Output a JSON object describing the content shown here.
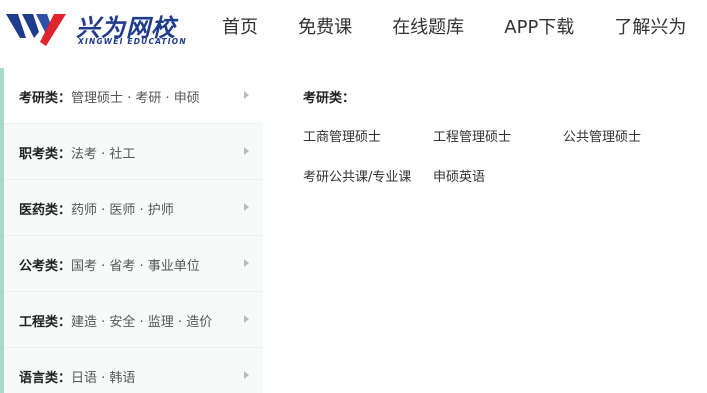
{
  "header": {
    "logo_text": "兴为网校",
    "logo_sub": "XINGWEI EDUCATION",
    "nav": [
      "首页",
      "免费课",
      "在线题库",
      "APP下载",
      "了解兴为"
    ]
  },
  "sidebar": {
    "items": [
      {
        "category": "考研类：",
        "subs": "管理硕士 · 考研 · 申硕"
      },
      {
        "category": "职考类：",
        "subs": "法考 · 社工"
      },
      {
        "category": "医药类：",
        "subs": "药师 · 医师 · 护师"
      },
      {
        "category": "公考类：",
        "subs": "国考 · 省考 · 事业单位"
      },
      {
        "category": "工程类：",
        "subs": "建造 · 安全 · 监理 · 造价"
      },
      {
        "category": "语言类：",
        "subs": "日语 · 韩语"
      }
    ]
  },
  "panel": {
    "title": "考研类：",
    "courses": [
      "工商管理硕士",
      "工程管理硕士",
      "公共管理硕士",
      "考研公共课/专业课",
      "申硕英语"
    ]
  },
  "colors": {
    "brand_blue": "#1f3b8c",
    "brand_red": "#e0242e",
    "sidebar_bg": "#f6faf8",
    "sidebar_strip": "#a8dcc0"
  },
  "icons": {
    "logo_mark": "xingwei-logo-mark",
    "arrow": "chevron-right-icon"
  }
}
